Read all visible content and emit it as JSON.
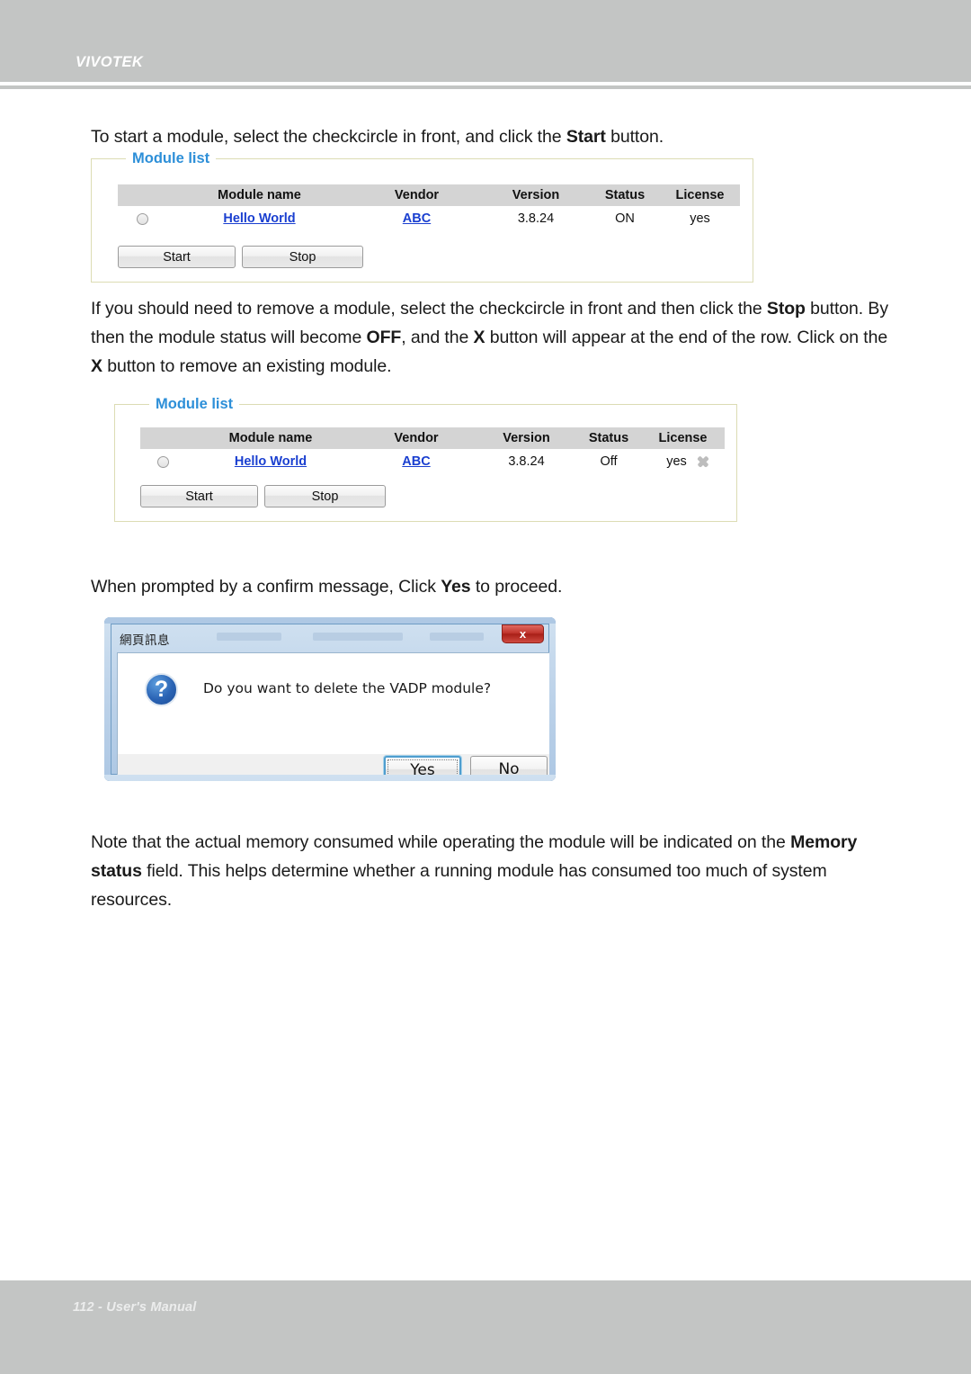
{
  "header": {
    "brand": "VIVOTEK"
  },
  "paragraphs": {
    "start_module": {
      "pre": "To start a module, select the checkcircle in front, and click the ",
      "bold": "Start",
      "post": " button."
    },
    "remove_module": {
      "p1": "If you should need to remove a module, select the checkcircle in front and then click the ",
      "b1": "Stop",
      "p2": " button. By then the module status will become ",
      "b2": "OFF",
      "p3": ", and the ",
      "b3": "X",
      "p4": " button will appear at the end of the row. Click on the ",
      "b4": "X",
      "p5": " button to remove an existing module."
    },
    "confirm_prompt": {
      "pre": "When prompted by a confirm message, Click ",
      "bold": "Yes",
      "post": " to proceed."
    },
    "memory_note": {
      "p1": "Note that the actual memory consumed while operating the module will be indicated on the ",
      "b1": "Memory status",
      "p2": " field. This helps determine whether a running module has consumed too much of system resources."
    }
  },
  "module_list_1": {
    "legend": "Module list",
    "columns": [
      "",
      "Module name",
      "Vendor",
      "Version",
      "Status",
      "License"
    ],
    "rows": [
      {
        "selector": "radio",
        "module_name": "Hello World",
        "vendor": "ABC",
        "version": "3.8.24",
        "status": "ON",
        "license": "yes",
        "delete": ""
      }
    ],
    "buttons": {
      "start": "Start",
      "stop": "Stop"
    }
  },
  "module_list_2": {
    "legend": "Module list",
    "columns": [
      "",
      "Module name",
      "Vendor",
      "Version",
      "Status",
      "License"
    ],
    "rows": [
      {
        "selector": "radio",
        "module_name": "Hello World",
        "vendor": "ABC",
        "version": "3.8.24",
        "status": "Off",
        "license": "yes",
        "delete": "x-icon"
      }
    ],
    "buttons": {
      "start": "Start",
      "stop": "Stop"
    }
  },
  "dialog": {
    "title": "網頁訊息",
    "close_label": "x",
    "icon": "question-icon",
    "message": "Do you want to delete the VADP module?",
    "buttons": {
      "yes": "Yes",
      "no": "No"
    }
  },
  "footer": {
    "text": "112 - User's Manual"
  },
  "colors": {
    "header_gray": "#c3c5c4",
    "legend_blue": "#2d8fd8",
    "fieldset_border": "#dcdcb4",
    "table_header_gray": "#d4d4d4",
    "link_blue": "#1a3fd0",
    "close_red": "#c0342c",
    "question_blue": "#2a63b4"
  }
}
